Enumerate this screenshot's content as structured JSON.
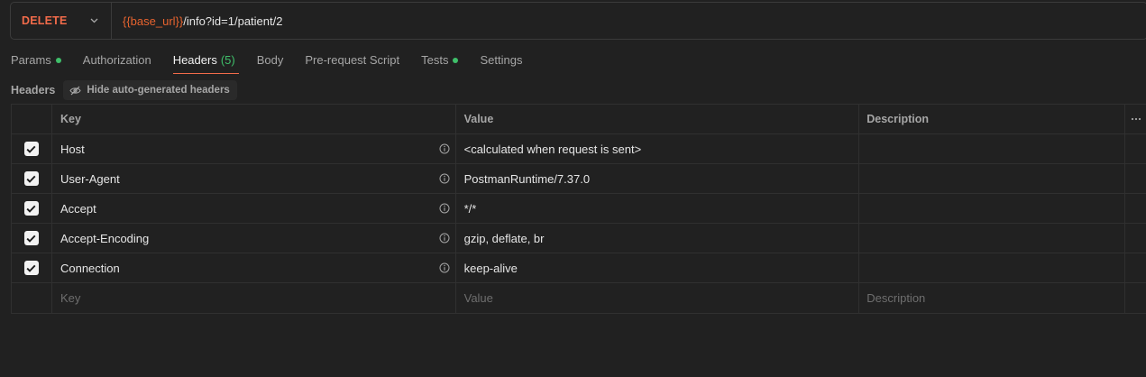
{
  "request": {
    "method": "DELETE",
    "url_variable": "{{base_url}}",
    "url_rest": "/info?id=1/patient/2"
  },
  "tabs": [
    {
      "label": "Params",
      "dot": true
    },
    {
      "label": "Authorization"
    },
    {
      "label": "Headers",
      "count": "(5)",
      "active": true
    },
    {
      "label": "Body"
    },
    {
      "label": "Pre-request Script"
    },
    {
      "label": "Tests",
      "dot": true
    },
    {
      "label": "Settings"
    }
  ],
  "headers_section": {
    "title": "Headers",
    "hide_button": "Hide auto-generated headers"
  },
  "table": {
    "columns": {
      "key": "Key",
      "value": "Value",
      "description": "Description"
    },
    "rows": [
      {
        "key": "Host",
        "value": "<calculated when request is sent>",
        "checked": true
      },
      {
        "key": "User-Agent",
        "value": "PostmanRuntime/7.37.0",
        "checked": true
      },
      {
        "key": "Accept",
        "value": "*/*",
        "checked": true
      },
      {
        "key": "Accept-Encoding",
        "value": "gzip, deflate, br",
        "checked": true
      },
      {
        "key": "Connection",
        "value": "keep-alive",
        "checked": true
      }
    ],
    "placeholders": {
      "key": "Key",
      "value": "Value",
      "description": "Description"
    }
  },
  "colors": {
    "method": "#f26b4a",
    "url_variable": "#e8642f",
    "dot": "#3fbf6a",
    "active_underline": "#f26b4a"
  },
  "icons": {
    "method_dropdown": "chevron-down-icon",
    "hide_headers": "eye-off-icon",
    "info": "info-icon",
    "more": "more-horizontal-icon",
    "checkbox": "check-icon"
  }
}
